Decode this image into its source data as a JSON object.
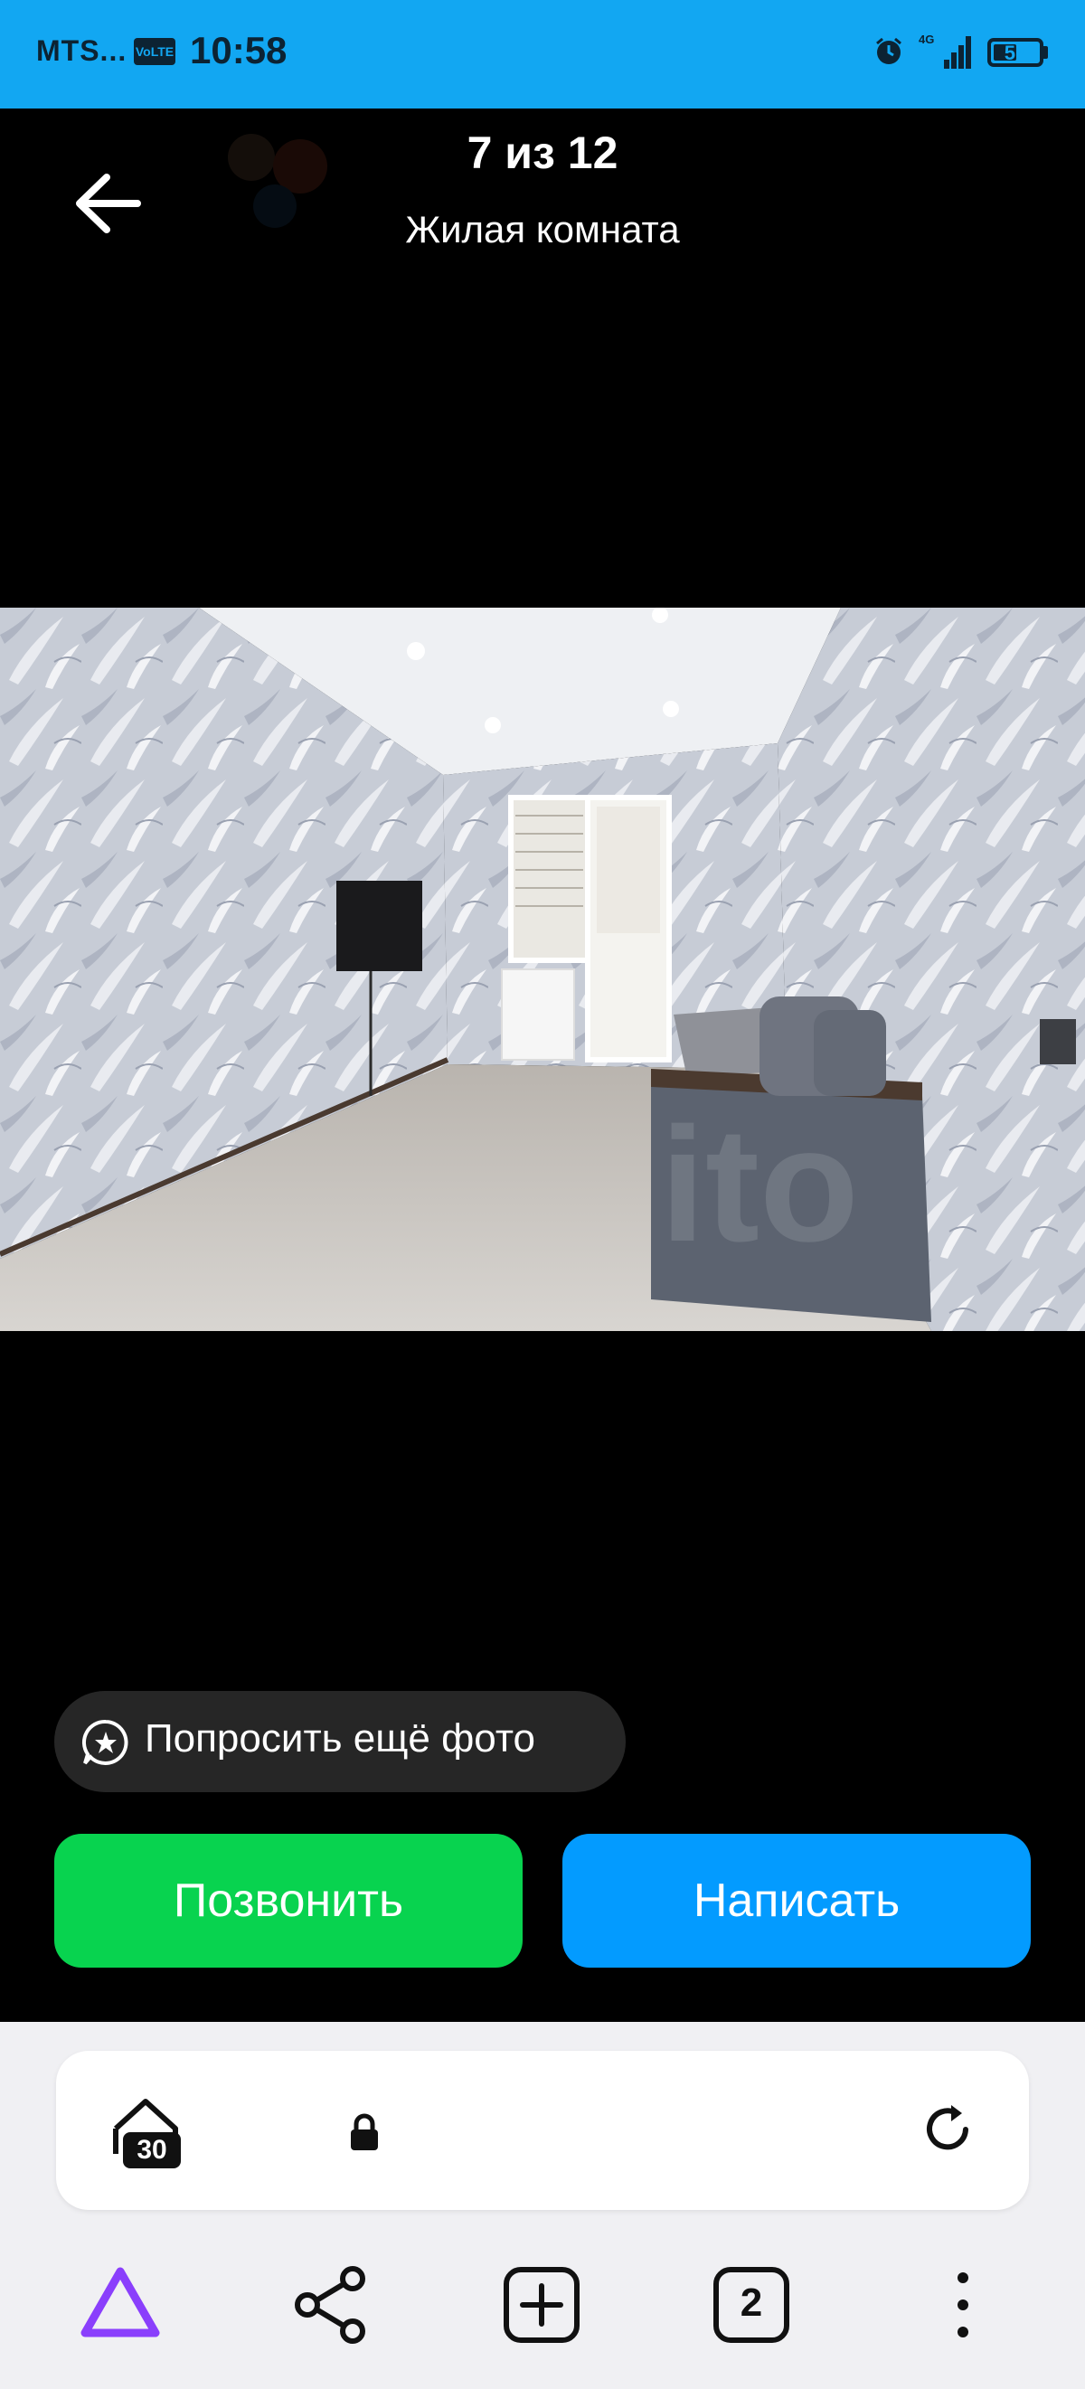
{
  "status_bar": {
    "carrier": "MTS...",
    "volte": "VoLTE",
    "time": "10:58",
    "battery": "57",
    "battery_level": 0.57,
    "network": "4G"
  },
  "header": {
    "counter": "7 из 12",
    "caption": "Жилая комната"
  },
  "actions": {
    "ask_photo": "Попросить ещё фото",
    "call": "Позвонить",
    "message": "Написать"
  },
  "browser": {
    "protected_count": "30",
    "tabs_count": "2"
  },
  "colors": {
    "status_bar": "#12a7f2",
    "call": "#08d34f",
    "message": "#039bff",
    "alice": "#8a3ffc"
  },
  "icons": [
    "back-arrow-icon",
    "alarm-icon",
    "signal-icon",
    "battery-icon",
    "chat-star-icon",
    "shield-icon",
    "lock-icon",
    "reload-icon",
    "alice-icon",
    "share-icon",
    "plus-icon",
    "tabs-icon",
    "more-icon"
  ]
}
